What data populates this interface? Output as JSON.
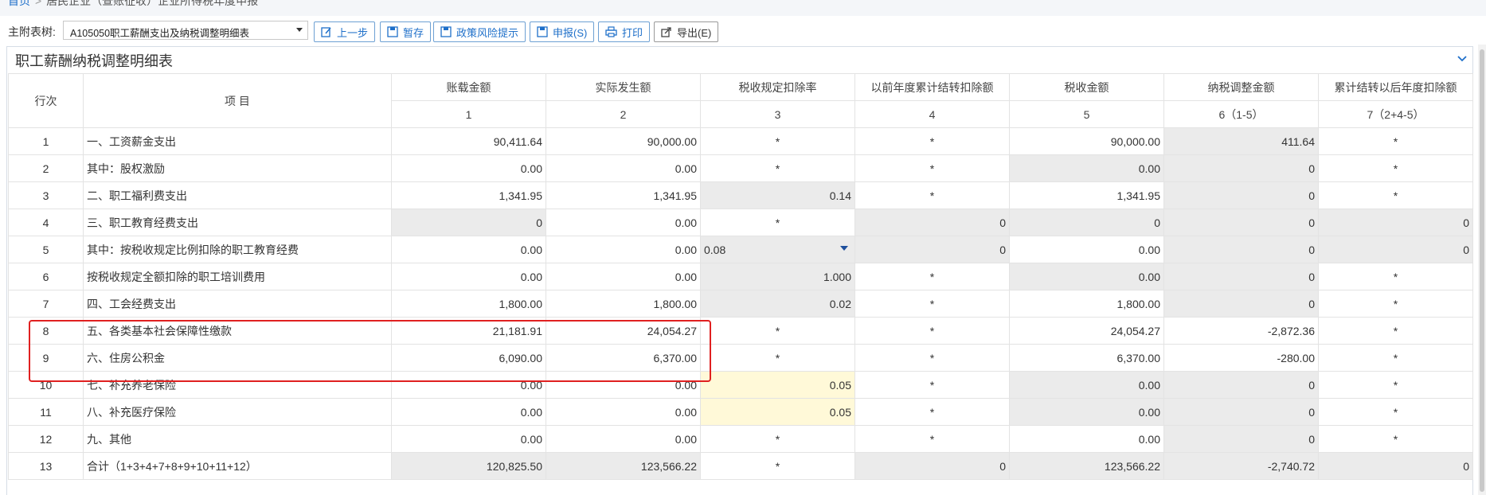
{
  "breadcrumb": {
    "home": "首页",
    "separator": ">",
    "current": "居民企业（查账征收）企业所得税年度申报"
  },
  "toolbar": {
    "label": "主附表树:",
    "selected_table": "A105050职工薪酬支出及纳税调整明细表",
    "buttons": {
      "prev": "上一步",
      "save": "暂存",
      "risk": "政策风险提示",
      "declare": "申报(S)",
      "print": "打印",
      "export": "导出(E)"
    }
  },
  "panel": {
    "title": "职工薪酬纳税调整明细表"
  },
  "table": {
    "header": {
      "seq": "行次",
      "item": "项 目",
      "columns": [
        "账载金额",
        "实际发生额",
        "税收规定扣除率",
        "以前年度累计结转扣除额",
        "税收金额",
        "纳税调整金额",
        "累计结转以后年度扣除额"
      ],
      "numbers": [
        "1",
        "2",
        "3",
        "4",
        "5",
        "6（1-5）",
        "7（2+4-5）"
      ]
    },
    "rows": [
      {
        "seq": "1",
        "item": "一、工资薪金支出",
        "cells": [
          "90,411.64",
          "90,000.00",
          "*",
          "*",
          "90,000.00",
          "411.64",
          "*"
        ]
      },
      {
        "seq": "2",
        "item": "其中：股权激励",
        "cells": [
          "0.00",
          "0.00",
          "*",
          "*",
          "0.00",
          "0",
          "*"
        ]
      },
      {
        "seq": "3",
        "item": "二、职工福利费支出",
        "cells": [
          "1,341.95",
          "1,341.95",
          "0.14",
          "*",
          "1,341.95",
          "0",
          "*"
        ]
      },
      {
        "seq": "4",
        "item": "三、职工教育经费支出",
        "cells": [
          "0",
          "0.00",
          "*",
          "0",
          "0",
          "0",
          "0"
        ]
      },
      {
        "seq": "5",
        "item": "其中：按税收规定比例扣除的职工教育经费",
        "cells": [
          "0.00",
          "0.00",
          "0.08",
          "0",
          "0.00",
          "0",
          "0"
        ]
      },
      {
        "seq": "6",
        "item": "按税收规定全额扣除的职工培训费用",
        "cells": [
          "0.00",
          "0.00",
          "1.000",
          "*",
          "0.00",
          "0",
          "*"
        ]
      },
      {
        "seq": "7",
        "item": "四、工会经费支出",
        "cells": [
          "1,800.00",
          "1,800.00",
          "0.02",
          "*",
          "1,800.00",
          "0",
          "*"
        ]
      },
      {
        "seq": "8",
        "item": "五、各类基本社会保障性缴款",
        "cells": [
          "21,181.91",
          "24,054.27",
          "*",
          "*",
          "24,054.27",
          "-2,872.36",
          "*"
        ]
      },
      {
        "seq": "9",
        "item": "六、住房公积金",
        "cells": [
          "6,090.00",
          "6,370.00",
          "*",
          "*",
          "6,370.00",
          "-280.00",
          "*"
        ]
      },
      {
        "seq": "10",
        "item": "七、补充养老保险",
        "cells": [
          "0.00",
          "0.00",
          "0.05",
          "*",
          "0.00",
          "0",
          "*"
        ]
      },
      {
        "seq": "11",
        "item": "八、补充医疗保险",
        "cells": [
          "0.00",
          "0.00",
          "0.05",
          "*",
          "0.00",
          "0",
          "*"
        ]
      },
      {
        "seq": "12",
        "item": "九、其他",
        "cells": [
          "0.00",
          "0.00",
          "*",
          "*",
          "0.00",
          "0",
          "*"
        ]
      },
      {
        "seq": "13",
        "item": "合计（1+3+4+7+8+9+10+11+12）",
        "cells": [
          "120,825.50",
          "123,566.22",
          "*",
          "0",
          "123,566.22",
          "-2,740.72",
          "0"
        ]
      }
    ]
  }
}
